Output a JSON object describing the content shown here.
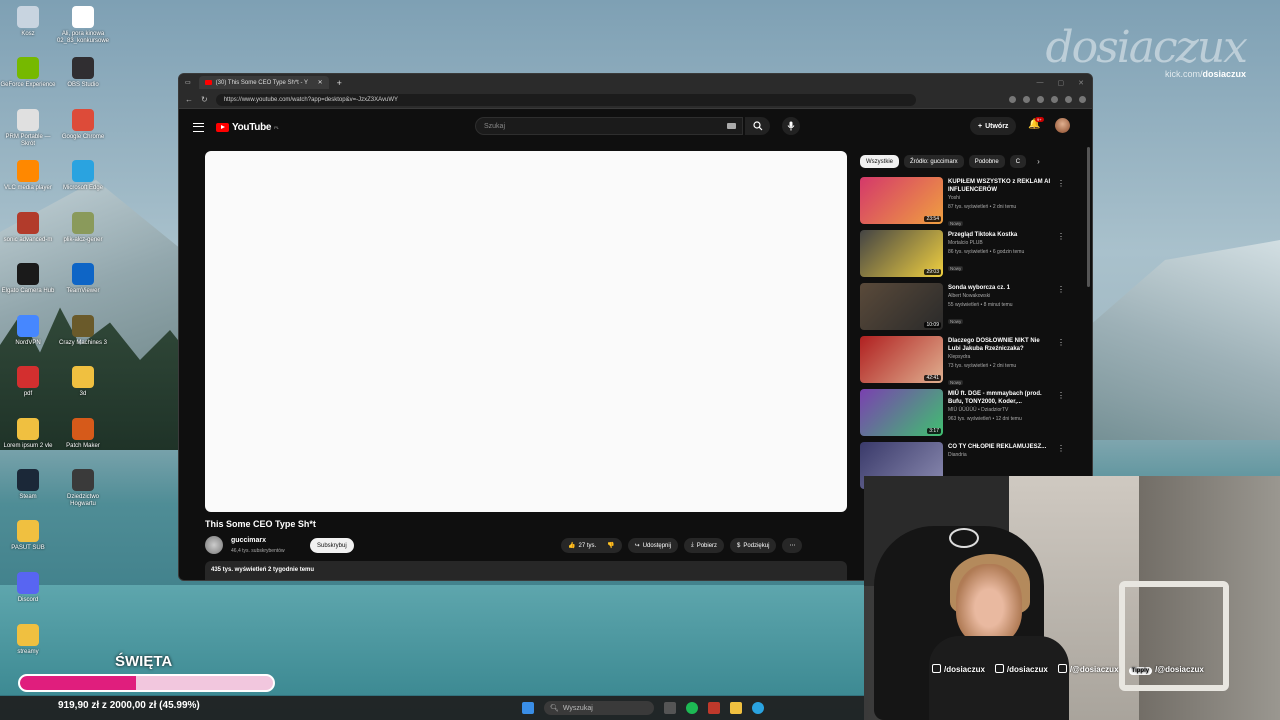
{
  "desktop": {
    "icons": [
      {
        "label": "Kosz",
        "color": "#c8d4e0"
      },
      {
        "label": "Ali, pora kinowa 02_83_konkursowe",
        "color": "#ffffff"
      },
      {
        "label": "GeForce Experience",
        "color": "#76b900"
      },
      {
        "label": "OBS Studio",
        "color": "#302e31"
      },
      {
        "label": "PRM Portable — Skrót",
        "color": "#e0e0e0"
      },
      {
        "label": "Google Chrome",
        "color": "#dd4b39"
      },
      {
        "label": "VLC media player",
        "color": "#ff8800"
      },
      {
        "label": "Microsoft Edge",
        "color": "#2aa3e0"
      },
      {
        "label": "sonic advanced-m",
        "color": "#b23b2b"
      },
      {
        "label": "plik-alcz-gener",
        "color": "#8a9a5b"
      },
      {
        "label": "Elgato Camera Hub",
        "color": "#1a1a1a"
      },
      {
        "label": "TeamViewer",
        "color": "#0e65c6"
      },
      {
        "label": "NordVPN",
        "color": "#4687ff"
      },
      {
        "label": "Crazy Machines 3",
        "color": "#6a5a2a"
      },
      {
        "label": "pdf",
        "color": "#d32f2f"
      },
      {
        "label": "3d",
        "color": "#f0c040"
      },
      {
        "label": "Lorem ipsum 2 vle",
        "color": "#f0c040"
      },
      {
        "label": "Patch Maker",
        "color": "#d65a1a"
      },
      {
        "label": "Steam",
        "color": "#1b2838"
      },
      {
        "label": "Dziedzictwo Hogwartu",
        "color": "#3a3a3a"
      },
      {
        "label": "PASUT SUB",
        "color": "#f0c040"
      },
      {
        "label": "Discord",
        "color": "#5865f2"
      },
      {
        "label": "streamy",
        "color": "#f0c040"
      }
    ]
  },
  "watermark": {
    "logo": "dosiaczux",
    "kick_prefix": "kick.com/",
    "kick_user": "dosiaczux"
  },
  "browser": {
    "tab_title": "(30) This Some CEO Type Sh*t - Y",
    "new_tab": "+",
    "url": "https://www.youtube.com/watch?app=desktop&v=-JzxZ3XAvuWY",
    "nav_back": "←",
    "nav_refresh": "↻"
  },
  "youtube": {
    "logo_text": "YouTube",
    "logo_region": "PL",
    "search_placeholder": "Szukaj",
    "create_label": "Utwórz",
    "notif_count": "9+",
    "video_title": "This Some CEO Type Sh*t",
    "channel_name": "guccimarx",
    "channel_subs": "46,4 tys. subskrybentów",
    "subscribe_label": "Subskrybuj",
    "like_count": "27 tys.",
    "share_label": "Udostępnij",
    "download_label": "Pobierz",
    "thanks_label": "Podziękuj",
    "views_line": "435 tys. wyświetleń  2 tygodnie temu",
    "chips": [
      "Wszystkie",
      "Źródło: guccimarx",
      "Podobne",
      "C"
    ],
    "recommendations": [
      {
        "title": "KUPIŁEM WSZYSTKO z REKLAM AI INFLUENCERÓW",
        "channel": "Yoshi",
        "meta": "87 tys. wyświetleń • 2 dni temu",
        "duration": "23:54",
        "badge": "Nowy",
        "c1": "#d4386a",
        "c2": "#f0a040"
      },
      {
        "title": "Przegląd Tiktoka Kostka",
        "channel": "Mortalcio PLUB",
        "meta": "86 tys. wyświetleń • 6 godzin temu",
        "duration": "29:03",
        "badge": "Nowy",
        "c1": "#444444",
        "c2": "#f0d040"
      },
      {
        "title": "Sonda wyborcza cz. 1",
        "channel": "Albert Nowakowski",
        "meta": "55 wyświetleń • 8 minut temu",
        "duration": "10:09",
        "badge": "Nowy",
        "c1": "#5a4a3a",
        "c2": "#2a2a2a"
      },
      {
        "title": "Dlaczego DOSŁOWNIE NIKT Nie Lubi Jakuba Rzeźniczaka?",
        "channel": "Klepsydra",
        "meta": "73 tys. wyświetleń • 2 dni temu",
        "duration": "42:41",
        "badge": "Nowy",
        "c1": "#b02020",
        "c2": "#e0b090"
      },
      {
        "title": "MIŪ ft. DGE - mmmaybach (prod. Bufu, TONY2000, Koder,...",
        "channel": "MIŪ ŪŪŪŪŪ • DziadziorTV",
        "meta": "963 tys. wyświetleń • 12 dni temu",
        "duration": "3:17",
        "badge": "",
        "c1": "#7a40b0",
        "c2": "#40c070"
      },
      {
        "title": "CO TY CHŁOPIE REKLAMUJESZ...",
        "channel": "Diandria",
        "meta": "",
        "duration": "",
        "badge": "",
        "c1": "#3a3a6a",
        "c2": "#8a8ab0"
      }
    ]
  },
  "webcam": {
    "socials": [
      {
        "handle": "/dosiaczux",
        "icon": "instagram-icon"
      },
      {
        "handle": "/dosiaczux",
        "icon": "tiktok-icon"
      },
      {
        "handle": "/@dosiaczux",
        "icon": "youtube-icon"
      },
      {
        "handle": "/@dosiaczux",
        "icon": "tipply-icon",
        "prefix": "Tipply"
      }
    ]
  },
  "goal": {
    "title": "ŚWIĘTA",
    "amount_text": "919,90 zł z 2000,00 zł (45.99%)",
    "progress": 0.4599,
    "fill_color": "#e01e7d",
    "track_color": "#f2c7de"
  },
  "taskbar": {
    "search_placeholder": "Wyszukaj"
  }
}
